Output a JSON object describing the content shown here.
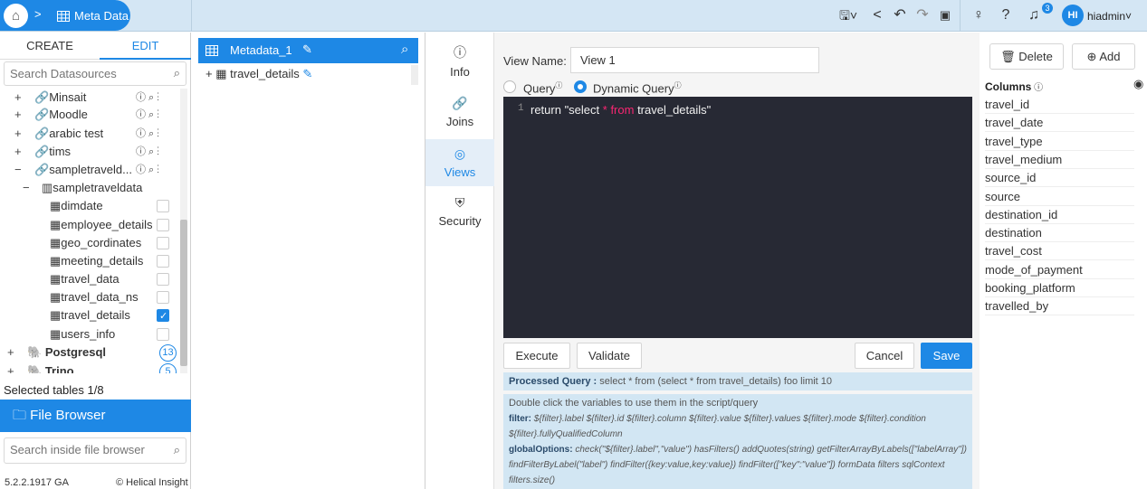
{
  "breadcrumb": {
    "current": "Meta Data"
  },
  "user": {
    "initials": "HI",
    "name": "hiadmin"
  },
  "notifications": {
    "count": "3"
  },
  "left": {
    "tabs": {
      "create": "CREATE",
      "edit": "EDIT"
    },
    "search_placeholder": "Search Datasources",
    "tree": [
      {
        "toggle": "+",
        "label": "Minsait",
        "type": "connection",
        "indent": 0
      },
      {
        "toggle": "+",
        "label": "Moodle",
        "type": "connection",
        "indent": 0
      },
      {
        "toggle": "+",
        "label": "arabic test",
        "type": "connection",
        "indent": 0
      },
      {
        "toggle": "+",
        "label": "tims",
        "type": "connection",
        "indent": 0
      },
      {
        "toggle": "−",
        "label": "sampletraveld...",
        "type": "connection",
        "indent": 0
      },
      {
        "toggle": "−",
        "label": "sampletraveldata",
        "type": "schema",
        "indent": 1
      },
      {
        "label": "dimdate",
        "type": "table",
        "checked": false
      },
      {
        "label": "employee_details",
        "type": "table",
        "checked": false
      },
      {
        "label": "geo_cordinates",
        "type": "table",
        "checked": false
      },
      {
        "label": "meeting_details",
        "type": "table",
        "checked": false
      },
      {
        "label": "travel_data",
        "type": "table",
        "checked": false
      },
      {
        "label": "travel_data_ns",
        "type": "table",
        "checked": false
      },
      {
        "label": "travel_details",
        "type": "table",
        "checked": true
      },
      {
        "label": "users_info",
        "type": "table",
        "checked": false
      },
      {
        "toggle": "+",
        "label": "Postgresql",
        "type": "group",
        "count": "13"
      },
      {
        "toggle": "+",
        "label": "Trino",
        "type": "group",
        "count": "5"
      }
    ],
    "selected_tables": "Selected tables 1/8",
    "file_browser": "File Browser",
    "file_search_placeholder": "Search inside file browser",
    "version": "5.2.2.1917 GA",
    "brand": "© Helical Insight"
  },
  "middle": {
    "title": "Metadata_1",
    "node": "travel_details",
    "node_toggle": "+"
  },
  "nav": [
    {
      "label": "Info",
      "icon": "ⓘ"
    },
    {
      "label": "Joins",
      "icon": "🔗"
    },
    {
      "label": "Views",
      "icon": "◎",
      "active": true
    },
    {
      "label": "Security",
      "icon": "⛨"
    }
  ],
  "editor": {
    "view_name_label": "View Name:",
    "view_name_value": "View 1",
    "query_label": "Query",
    "dynamic_query_label": "Dynamic Query",
    "query_type": "Dynamic Query",
    "code": {
      "line_number": "1",
      "before": "return \"select ",
      "star": "*",
      "kw": " from ",
      "after": "travel_details\""
    },
    "buttons": {
      "execute": "Execute",
      "validate": "Validate",
      "cancel": "Cancel",
      "save": "Save"
    },
    "processed_label": "Processed Query :",
    "processed_value": " select * from (select * from travel_details) foo limit 10",
    "help": {
      "intro": "Double click the variables to use them in the script/query",
      "filter_label": "filter:",
      "filter_text": " ${filter}.label ${filter}.id ${filter}.column ${filter}.value ${filter}.values ${filter}.mode ${filter}.condition ${filter}.fullyQualifiedColumn",
      "global_label": "globalOptions:",
      "global_text": " check(\"${filter}.label\",\"value\") hasFilters() addQuotes(string) getFilterArrayByLabels([\"labelArray\"]) findFilterByLabel(\"label\") findFilter({key:value,key:value}) findFilter([\"key\":\"value\"]) formData filters sqlContext filters.size()"
    }
  },
  "right": {
    "delete_label": "Delete",
    "add_label": "Add",
    "columns_title": "Columns",
    "columns": [
      "travel_id",
      "travel_date",
      "travel_type",
      "travel_medium",
      "source_id",
      "source",
      "destination_id",
      "destination",
      "travel_cost",
      "mode_of_payment",
      "booking_platform",
      "travelled_by"
    ]
  },
  "colors": {
    "accent": "#1e88e5",
    "topbar": "#d4e6f4",
    "editor_bg": "#272934",
    "keyword": "#f92672"
  }
}
